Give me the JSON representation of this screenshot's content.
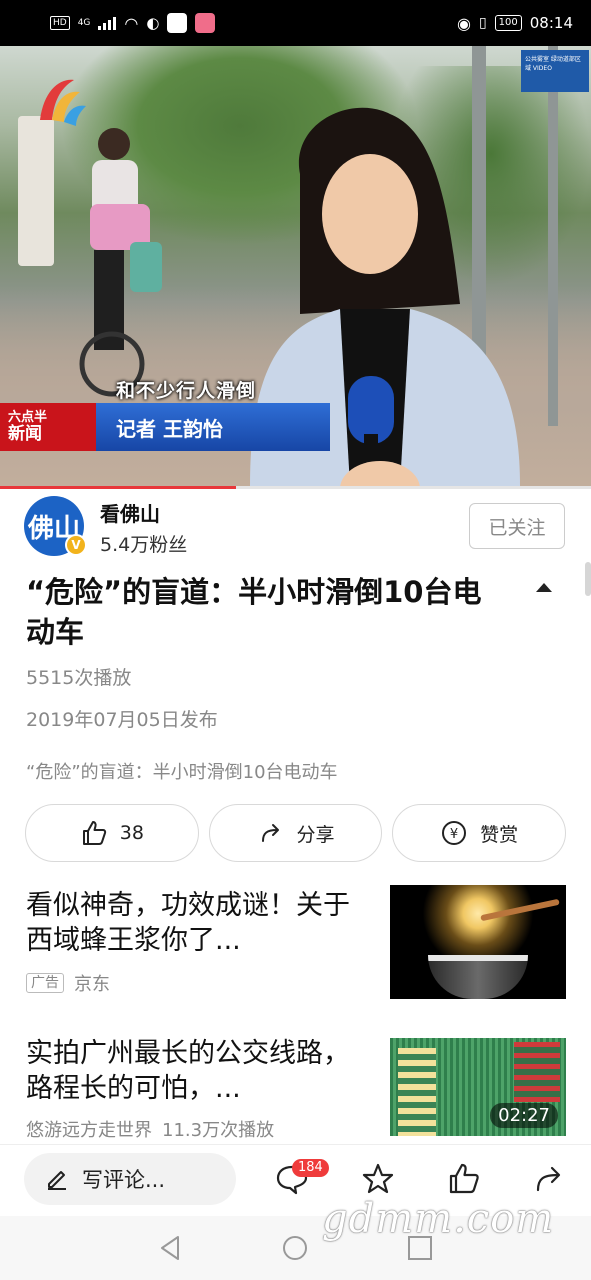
{
  "status_bar": {
    "hd": "HD",
    "network": "4G",
    "battery": "100",
    "time": "08:14"
  },
  "video": {
    "caption": "和不少行人滑倒",
    "show_name_top": "六点半",
    "show_name_bottom": "新闻",
    "reporter_label": "记者 王韵怡",
    "progress": 0.4,
    "sign_text": "公共雾室 绿动道部区域 VIDEO"
  },
  "author": {
    "name": "看佛山",
    "avatar_text": "佛山",
    "fans": "5.4万粉丝",
    "follow_label": "已关注"
  },
  "article": {
    "title": "“危险”的盲道：半小时滑倒10台电动车",
    "plays": "5515次播放",
    "date": "2019年07月05日发布",
    "description": "“危险”的盲道：半小时滑倒10台电动车"
  },
  "actions": {
    "like_count": "38",
    "share_label": "分享",
    "reward_label": "赞赏"
  },
  "feed": [
    {
      "title": "看似神奇，功效成谜！关于西域蜂王浆你了...",
      "ad_tag": "广告",
      "source": "京东"
    },
    {
      "title": "实拍广州最长的公交线路，路程长的可怕，...",
      "source": "悠游远方走世界",
      "plays": "11.3万次播放",
      "duration": "02:27"
    }
  ],
  "bottom_bar": {
    "comment_placeholder": "写评论...",
    "comment_count": "184"
  },
  "watermark": "gdmm.com",
  "colors": {
    "accent_red": "#e8373a",
    "brand_blue": "#1c63c5",
    "verified_gold": "#f2b31c"
  }
}
